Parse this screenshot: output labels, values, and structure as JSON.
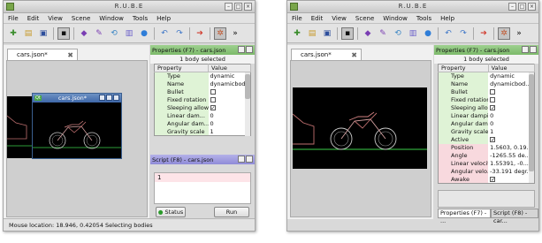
{
  "left_window": {
    "title": "R.U.B.E",
    "menus": [
      "File",
      "Edit",
      "View",
      "Scene",
      "Window",
      "Tools",
      "Help"
    ],
    "doc_tab": "cars.json*",
    "subwindow": {
      "badge": "Qt",
      "title": "cars.json*"
    },
    "properties": {
      "title": "Properties (F7) - cars.json",
      "selection": "1 body selected",
      "col_property": "Property",
      "col_value": "Value",
      "rows": [
        {
          "k": "Type",
          "v": "dynamic"
        },
        {
          "k": "Name",
          "v": "dynamicbod..."
        },
        {
          "k": "Bullet",
          "v": ""
        },
        {
          "k": "Fixed rotation",
          "v": ""
        },
        {
          "k": "Sleeping allowed",
          "v": "✓"
        },
        {
          "k": "Linear dam...",
          "v": "0"
        },
        {
          "k": "Angular dam...",
          "v": "0"
        },
        {
          "k": "Gravity scale",
          "v": "1"
        }
      ]
    },
    "script": {
      "title": "Script (F8) - cars.json",
      "line_number": "1",
      "status_label": "Status",
      "run_label": "Run"
    },
    "status_bar": "Mouse location: 18.946, 0.42054  Selecting bodies"
  },
  "right_window": {
    "title": "R.U.B.E",
    "menus": [
      "File",
      "Edit",
      "View",
      "Scene",
      "Window",
      "Tools",
      "Help"
    ],
    "doc_tab": "cars.json*",
    "properties": {
      "title": "Properties (F7) - cars.json",
      "selection": "1 body selected",
      "col_property": "Property",
      "col_value": "Value",
      "rows": [
        {
          "k": "Type",
          "v": "dynamic"
        },
        {
          "k": "Name",
          "v": "dynamicbod..."
        },
        {
          "k": "Bullet",
          "v": ""
        },
        {
          "k": "Fixed rotation",
          "v": ""
        },
        {
          "k": "Sleeping allo...",
          "v": "✓"
        },
        {
          "k": "Linear dampi...",
          "v": "0"
        },
        {
          "k": "Angular dam...",
          "v": "0"
        },
        {
          "k": "Gravity scale",
          "v": "1"
        },
        {
          "k": "Active",
          "v": "✓"
        },
        {
          "k": "Position",
          "v": "1.5603, 0.19..."
        },
        {
          "k": "Angle",
          "v": "-1265.55 de..."
        },
        {
          "k": "Linear velocity",
          "v": "1.55391, -0...."
        },
        {
          "k": "Angular velo...",
          "v": "-33.191 degr..."
        },
        {
          "k": "Awake",
          "v": "✓"
        }
      ]
    },
    "dock_tabs": [
      "Properties (F7) - ...",
      "Script (F8) - car..."
    ]
  },
  "toolbar_icons": [
    "new-icon",
    "open-icon",
    "save-icon",
    "select-mode-icon",
    "body-icon",
    "fixture-icon",
    "joint-icon",
    "image-icon",
    "circle-icon",
    "undo-icon",
    "redo-icon",
    "arrow-icon",
    "settings-icon",
    "more-icon"
  ],
  "colors": {
    "property_key": "#dff3d6",
    "property_key_highlight": "#f8d9de",
    "properties_header": "#8fc77e",
    "script_header": "#9f9be0",
    "subwindow_title": "#4a73b1"
  }
}
